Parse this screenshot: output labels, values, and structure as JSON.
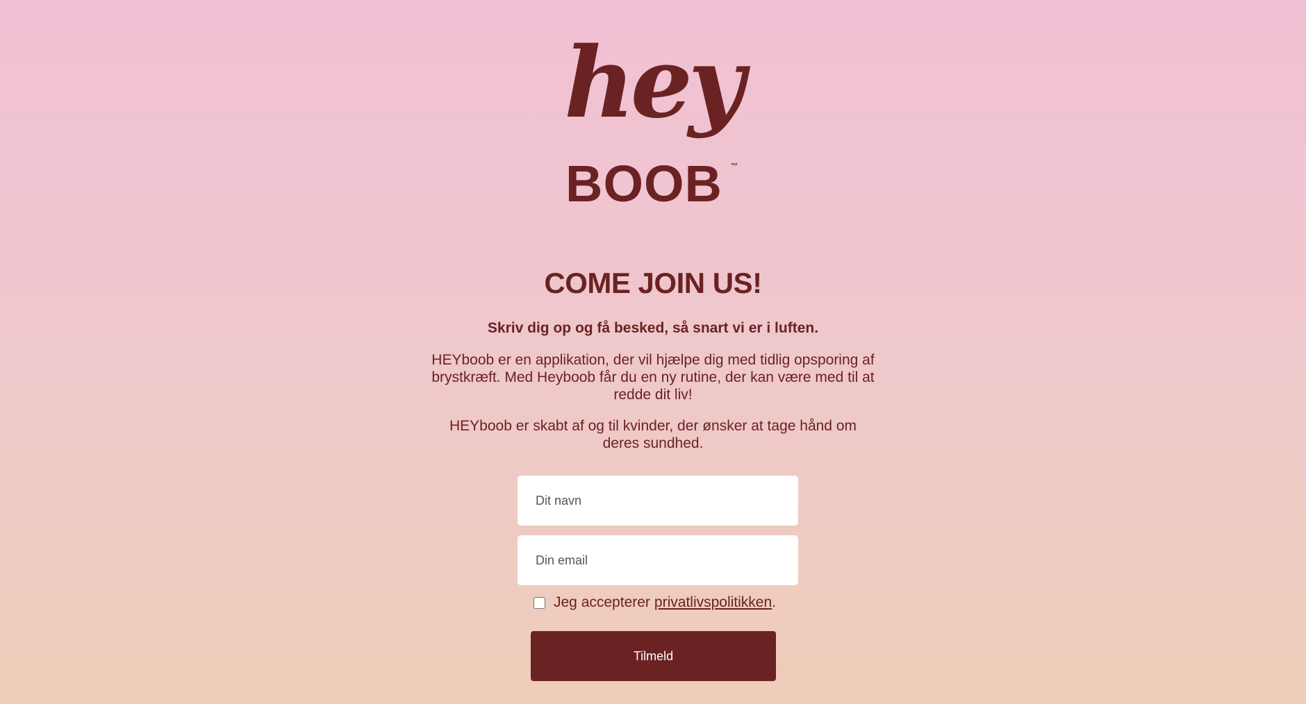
{
  "logo": {
    "word1": "hey",
    "word2": "BOOB",
    "trademark": "™"
  },
  "hero": {
    "title": "COME JOIN US!",
    "subtitle": "Skriv dig op og få besked, så snart vi er i luften.",
    "paragraph1": "HEYboob er en applikation, der vil hjælpe dig med tidlig opsporing af brystkræft. Med Heyboob får du en ny rutine, der kan være med til at redde dit liv!",
    "paragraph2": "HEYboob er skabt af og til kvinder, der ønsker at tage hånd om deres sundhed."
  },
  "form": {
    "name_placeholder": "Dit navn",
    "email_placeholder": "Din email",
    "consent_prefix": "Jeg accepterer",
    "consent_link": "privatlivspolitikken",
    "consent_suffix": ".",
    "consent_checked": false,
    "submit_label": "Tilmeld"
  },
  "colors": {
    "brand": "#6a2222",
    "bg_top": "#f1c0d4",
    "bg_bottom": "#efcdb8"
  }
}
